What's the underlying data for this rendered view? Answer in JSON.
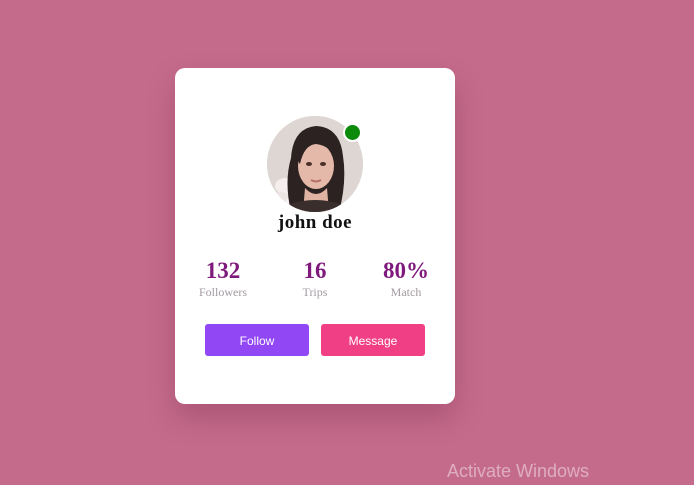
{
  "profile": {
    "name": "john doe",
    "online": true
  },
  "stats": [
    {
      "value": "132",
      "label": "Followers"
    },
    {
      "value": "16",
      "label": "Trips"
    },
    {
      "value": "80%",
      "label": "Match"
    }
  ],
  "actions": {
    "follow_label": "Follow",
    "message_label": "Message"
  },
  "watermark": {
    "text": "Activate Windows"
  },
  "colors": {
    "background": "#c46b8b",
    "card": "#ffffff",
    "stat_value": "#7f1a7d",
    "follow_button": "#9147f4",
    "message_button": "#f03f84",
    "online_status": "#0b8a0b"
  }
}
